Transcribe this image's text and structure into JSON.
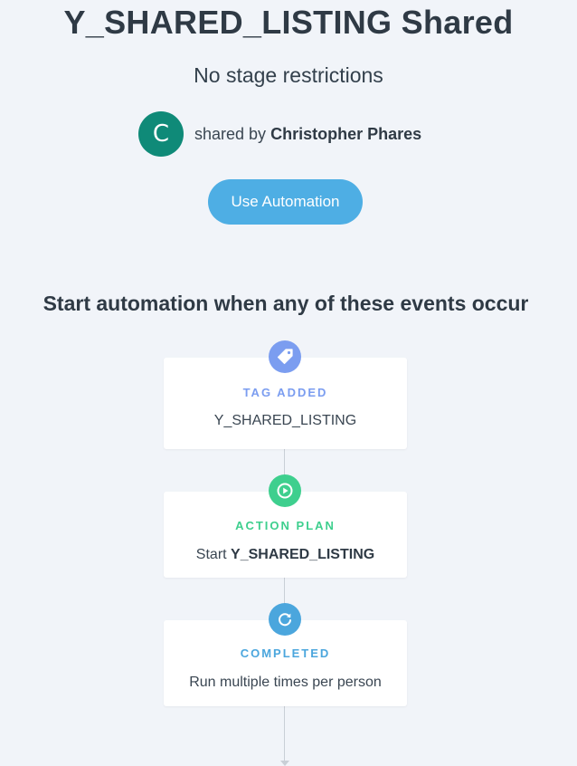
{
  "header": {
    "title": "Y_SHARED_LISTING Shared",
    "subtitle": "No stage restrictions"
  },
  "sharer": {
    "avatar_initial": "C",
    "avatar_color": "#0f8a78",
    "prefix": "shared by",
    "name": "Christopher Phares"
  },
  "use_button": {
    "label": "Use Automation",
    "color": "#4eaee4"
  },
  "section": {
    "heading": "Start automation when any of these events occur"
  },
  "steps": [
    {
      "icon": "tag-icon",
      "color": "#7b9df0",
      "label": "TAG ADDED",
      "value": "Y_SHARED_LISTING"
    },
    {
      "icon": "play-circle-icon",
      "color": "#3ecf8e",
      "label": "ACTION PLAN",
      "value_prefix": "Start",
      "value_bold": "Y_SHARED_LISTING"
    },
    {
      "icon": "refresh-icon",
      "color": "#4ba6dd",
      "label": "COMPLETED",
      "value": "Run multiple times per person"
    }
  ]
}
